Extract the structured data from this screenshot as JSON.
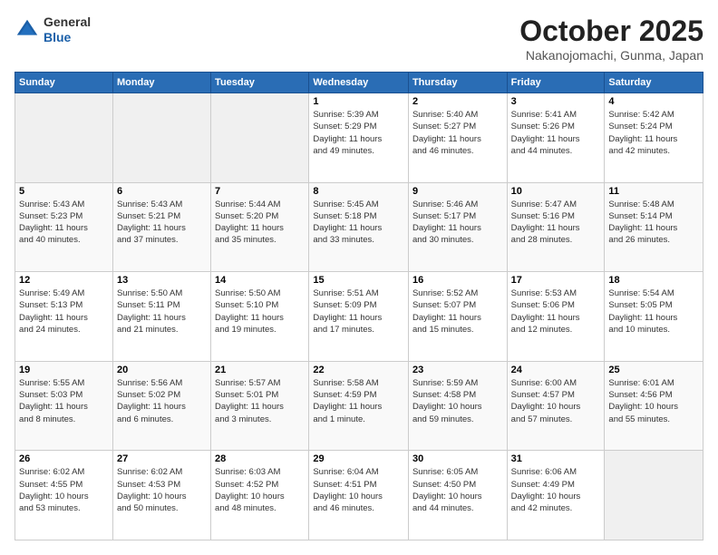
{
  "header": {
    "logo_line1": "General",
    "logo_line2": "Blue",
    "month": "October 2025",
    "location": "Nakanojomachi, Gunma, Japan"
  },
  "weekdays": [
    "Sunday",
    "Monday",
    "Tuesday",
    "Wednesday",
    "Thursday",
    "Friday",
    "Saturday"
  ],
  "weeks": [
    [
      {
        "day": "",
        "info": ""
      },
      {
        "day": "",
        "info": ""
      },
      {
        "day": "",
        "info": ""
      },
      {
        "day": "1",
        "info": "Sunrise: 5:39 AM\nSunset: 5:29 PM\nDaylight: 11 hours\nand 49 minutes."
      },
      {
        "day": "2",
        "info": "Sunrise: 5:40 AM\nSunset: 5:27 PM\nDaylight: 11 hours\nand 46 minutes."
      },
      {
        "day": "3",
        "info": "Sunrise: 5:41 AM\nSunset: 5:26 PM\nDaylight: 11 hours\nand 44 minutes."
      },
      {
        "day": "4",
        "info": "Sunrise: 5:42 AM\nSunset: 5:24 PM\nDaylight: 11 hours\nand 42 minutes."
      }
    ],
    [
      {
        "day": "5",
        "info": "Sunrise: 5:43 AM\nSunset: 5:23 PM\nDaylight: 11 hours\nand 40 minutes."
      },
      {
        "day": "6",
        "info": "Sunrise: 5:43 AM\nSunset: 5:21 PM\nDaylight: 11 hours\nand 37 minutes."
      },
      {
        "day": "7",
        "info": "Sunrise: 5:44 AM\nSunset: 5:20 PM\nDaylight: 11 hours\nand 35 minutes."
      },
      {
        "day": "8",
        "info": "Sunrise: 5:45 AM\nSunset: 5:18 PM\nDaylight: 11 hours\nand 33 minutes."
      },
      {
        "day": "9",
        "info": "Sunrise: 5:46 AM\nSunset: 5:17 PM\nDaylight: 11 hours\nand 30 minutes."
      },
      {
        "day": "10",
        "info": "Sunrise: 5:47 AM\nSunset: 5:16 PM\nDaylight: 11 hours\nand 28 minutes."
      },
      {
        "day": "11",
        "info": "Sunrise: 5:48 AM\nSunset: 5:14 PM\nDaylight: 11 hours\nand 26 minutes."
      }
    ],
    [
      {
        "day": "12",
        "info": "Sunrise: 5:49 AM\nSunset: 5:13 PM\nDaylight: 11 hours\nand 24 minutes."
      },
      {
        "day": "13",
        "info": "Sunrise: 5:50 AM\nSunset: 5:11 PM\nDaylight: 11 hours\nand 21 minutes."
      },
      {
        "day": "14",
        "info": "Sunrise: 5:50 AM\nSunset: 5:10 PM\nDaylight: 11 hours\nand 19 minutes."
      },
      {
        "day": "15",
        "info": "Sunrise: 5:51 AM\nSunset: 5:09 PM\nDaylight: 11 hours\nand 17 minutes."
      },
      {
        "day": "16",
        "info": "Sunrise: 5:52 AM\nSunset: 5:07 PM\nDaylight: 11 hours\nand 15 minutes."
      },
      {
        "day": "17",
        "info": "Sunrise: 5:53 AM\nSunset: 5:06 PM\nDaylight: 11 hours\nand 12 minutes."
      },
      {
        "day": "18",
        "info": "Sunrise: 5:54 AM\nSunset: 5:05 PM\nDaylight: 11 hours\nand 10 minutes."
      }
    ],
    [
      {
        "day": "19",
        "info": "Sunrise: 5:55 AM\nSunset: 5:03 PM\nDaylight: 11 hours\nand 8 minutes."
      },
      {
        "day": "20",
        "info": "Sunrise: 5:56 AM\nSunset: 5:02 PM\nDaylight: 11 hours\nand 6 minutes."
      },
      {
        "day": "21",
        "info": "Sunrise: 5:57 AM\nSunset: 5:01 PM\nDaylight: 11 hours\nand 3 minutes."
      },
      {
        "day": "22",
        "info": "Sunrise: 5:58 AM\nSunset: 4:59 PM\nDaylight: 11 hours\nand 1 minute."
      },
      {
        "day": "23",
        "info": "Sunrise: 5:59 AM\nSunset: 4:58 PM\nDaylight: 10 hours\nand 59 minutes."
      },
      {
        "day": "24",
        "info": "Sunrise: 6:00 AM\nSunset: 4:57 PM\nDaylight: 10 hours\nand 57 minutes."
      },
      {
        "day": "25",
        "info": "Sunrise: 6:01 AM\nSunset: 4:56 PM\nDaylight: 10 hours\nand 55 minutes."
      }
    ],
    [
      {
        "day": "26",
        "info": "Sunrise: 6:02 AM\nSunset: 4:55 PM\nDaylight: 10 hours\nand 53 minutes."
      },
      {
        "day": "27",
        "info": "Sunrise: 6:02 AM\nSunset: 4:53 PM\nDaylight: 10 hours\nand 50 minutes."
      },
      {
        "day": "28",
        "info": "Sunrise: 6:03 AM\nSunset: 4:52 PM\nDaylight: 10 hours\nand 48 minutes."
      },
      {
        "day": "29",
        "info": "Sunrise: 6:04 AM\nSunset: 4:51 PM\nDaylight: 10 hours\nand 46 minutes."
      },
      {
        "day": "30",
        "info": "Sunrise: 6:05 AM\nSunset: 4:50 PM\nDaylight: 10 hours\nand 44 minutes."
      },
      {
        "day": "31",
        "info": "Sunrise: 6:06 AM\nSunset: 4:49 PM\nDaylight: 10 hours\nand 42 minutes."
      },
      {
        "day": "",
        "info": ""
      }
    ]
  ]
}
